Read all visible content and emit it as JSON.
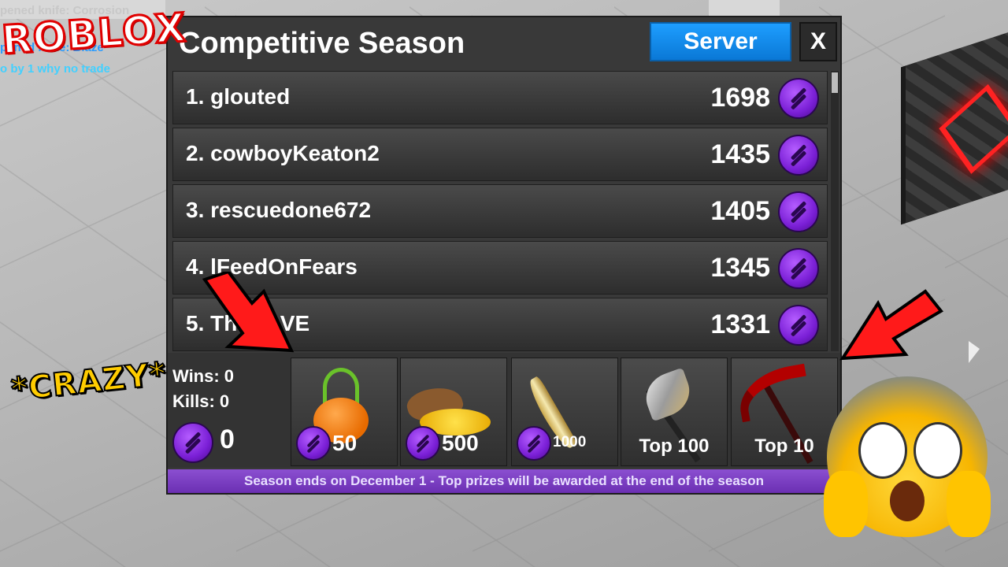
{
  "chat": {
    "line1": "pened knife: Corrosion",
    "line2": "pened knife: Blaze",
    "line3": "o by 1 why no trade"
  },
  "logo": "ROBLOX",
  "window": {
    "title": "Competitive Season",
    "server_label": "Server",
    "close_label": "X"
  },
  "leaderboard": [
    {
      "rank_name": "1. glouted",
      "score": "1698"
    },
    {
      "rank_name": "2. cowboyKeaton2",
      "score": "1435"
    },
    {
      "rank_name": "3. rescuedone672",
      "score": "1405"
    },
    {
      "rank_name": "4. lFeedOnFears",
      "score": "1345"
    },
    {
      "rank_name": "5. Th       VE",
      "score": "1331"
    }
  ],
  "stats": {
    "wins": "Wins: 0",
    "kills": "Kills: 0",
    "balance": "0"
  },
  "prizes": [
    {
      "item": "pumpkin-bucket",
      "price": "50"
    },
    {
      "item": "gold-sack",
      "price": "500"
    },
    {
      "item": "knife",
      "price": "1000"
    },
    {
      "item": "axe",
      "label": "Top 100"
    },
    {
      "item": "scythe",
      "label": "Top 10"
    }
  ],
  "footer": "Season ends on December 1 - Top prizes will be awarded at the end of the season",
  "overlay": {
    "crazy": "*CRAZY*"
  },
  "colors": {
    "server_button": "#0a78d6",
    "currency": "#8a2be2",
    "footer_bar": "#7b3fc4",
    "arrow": "#ff0000"
  }
}
